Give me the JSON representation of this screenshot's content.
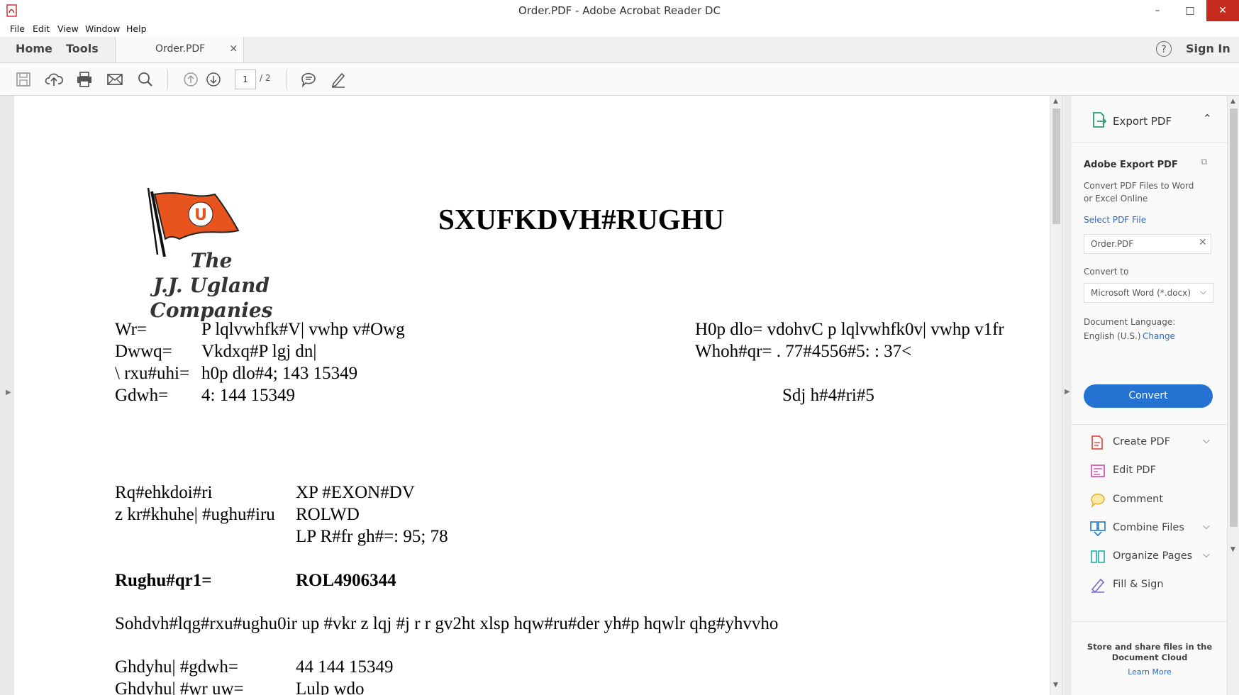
{
  "window": {
    "title": "Order.PDF - Adobe Acrobat Reader DC",
    "minimize": "–",
    "restore": "□",
    "close": "✕"
  },
  "menu": [
    "File",
    "Edit",
    "View",
    "Window",
    "Help"
  ],
  "tabs": {
    "home": "Home",
    "tools": "Tools",
    "document": "Order.PDF",
    "close": "×",
    "help": "?",
    "sign_in": "Sign In"
  },
  "toolbar": {
    "icons": [
      "save-icon",
      "upload-icon",
      "print-icon",
      "email-icon",
      "search-icon",
      "prev-page-icon",
      "next-page-icon",
      "comment-icon",
      "sign-pen-icon"
    ],
    "page_current": "1",
    "page_total": "/  2"
  },
  "document": {
    "title": "SXUFKDVH#RUGHU",
    "logo_text": [
      "The",
      "J.J. Ugland",
      "Companies"
    ],
    "header_left": [
      {
        "label": "Wr=",
        "value": "P lqlvwhfk#V| vwhp v#Owg"
      },
      {
        "label": "Dwwq=",
        "value": "Vkdxq#P lgj dn|"
      },
      {
        "label": "\\ rxu#uhi=",
        "value": "h0p dlo#4; 143 15349"
      },
      {
        "label": "Gdwh=",
        "value": "4: 144 15349"
      }
    ],
    "header_right": [
      "H0p dlo= vdohvC p lqlvwhfk0v| vwhp v1fr",
      "Whoh#qr= . 77#4556#5: : 37<"
    ],
    "page_label": "Sdj h#4#ri#5",
    "info_rows": [
      {
        "label": "Rq#ehkdoi#ri",
        "value": "XP #EXON#DV"
      },
      {
        "label": "z kr#khuhe| #ughu#iru",
        "value": "ROLWD"
      },
      {
        "label": "",
        "value": "LP R#fr gh#=: 95; 78"
      }
    ],
    "order_label": "Rughu#qr1=",
    "order_value": "ROL4906344",
    "notice": "Sohdvh#lqg#rxu#ughu0ir up #vkr z lqj #j r r gv2ht xlsp hqw#ru#der yh#p hqwlr qhg#yhvvho",
    "delivery_rows": [
      {
        "label": "Ghdyhu| #gdwh=",
        "value": "44 144 15349"
      },
      {
        "label": "Ghdyhu| #wr uw=",
        "value": "Lulp wdo"
      }
    ]
  },
  "right_panel": {
    "export_title": "Export PDF",
    "heading": "Adobe Export PDF",
    "description": "Convert PDF Files to Word or Excel Online",
    "select_label": "Select PDF File",
    "file_name": "Order.PDF",
    "convert_to_label": "Convert to",
    "format": "Microsoft Word (*.docx)",
    "doc_language_label": "Document Language:",
    "doc_language": "English (U.S.)",
    "change": "Change",
    "convert_button": "Convert",
    "tools": [
      {
        "label": "Create PDF",
        "icon": "create-pdf-icon",
        "chevron": true
      },
      {
        "label": "Edit PDF",
        "icon": "edit-pdf-icon",
        "chevron": false
      },
      {
        "label": "Comment",
        "icon": "comment-icon",
        "chevron": false
      },
      {
        "label": "Combine Files",
        "icon": "combine-files-icon",
        "chevron": true
      },
      {
        "label": "Organize Pages",
        "icon": "organize-pages-icon",
        "chevron": true
      },
      {
        "label": "Fill & Sign",
        "icon": "fill-sign-icon",
        "chevron": false
      }
    ],
    "store_text": "Store and share files in the Document Cloud",
    "learn_more": "Learn More"
  },
  "colors": {
    "accent": "#2473d3",
    "flag": "#e8541e",
    "close_button": "#c42b1c"
  }
}
